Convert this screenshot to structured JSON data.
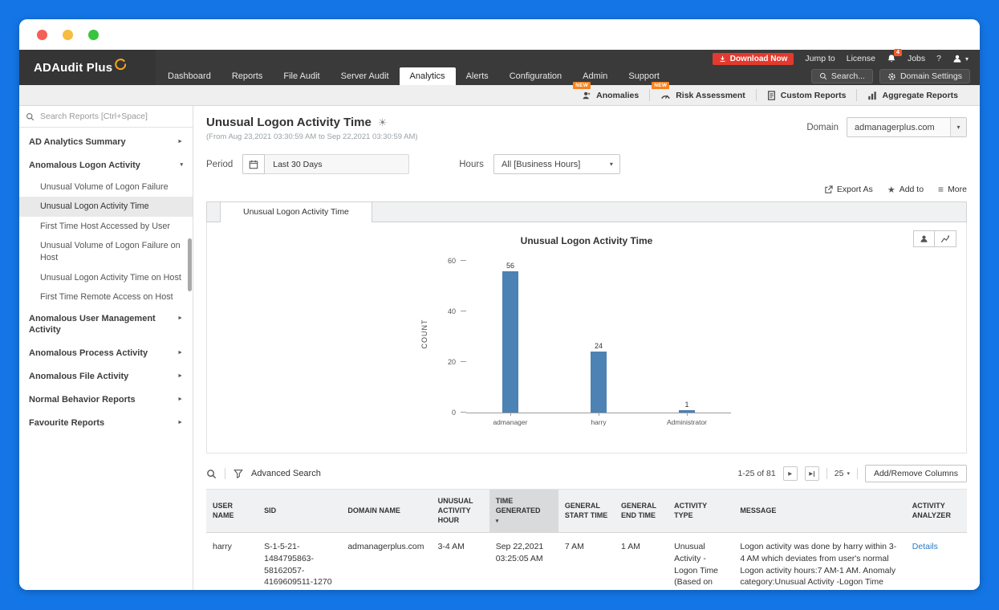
{
  "colors": {
    "frame_blue": "#1476E6",
    "header_dark": "#3a3a3a",
    "download_red": "#e23a2e",
    "badge_orange": "#f6821f",
    "bar_blue": "#4d82b4",
    "link_blue": "#2779c7"
  },
  "icons": {
    "caret_down": "▾",
    "caret_right": "►",
    "star": "★",
    "sun": "☀",
    "play": "▶",
    "more": "≡"
  },
  "topbar": {
    "brand": "ADAudit Plus",
    "download_label": "Download Now",
    "jump_to": "Jump to",
    "license": "License",
    "bell_count": "4",
    "jobs": "Jobs",
    "help": "?",
    "nav": [
      "Dashboard",
      "Reports",
      "File Audit",
      "Server Audit",
      "Analytics",
      "Alerts",
      "Configuration",
      "Admin",
      "Support"
    ],
    "active_nav": "Analytics",
    "search_label": "Search...",
    "domain_settings": "Domain Settings"
  },
  "ribbon": {
    "new_badge": "NEW",
    "anomalies": "Anomalies",
    "risk": "Risk Assessment",
    "custom": "Custom Reports",
    "aggregate": "Aggregate Reports"
  },
  "sidebar": {
    "search_placeholder": "Search Reports [Ctrl+Space]",
    "groups": [
      {
        "label": "AD Analytics Summary"
      },
      {
        "label": "Anomalous Logon Activity",
        "children": [
          "Unusual Volume of Logon Failure",
          "Unusual Logon Activity Time",
          "First Time Host Accessed by User",
          "Unusual Volume of Logon Failure on Host",
          "Unusual Logon Activity Time on Host",
          "First Time Remote Access on Host"
        ]
      },
      {
        "label": "Anomalous User Management Activity"
      },
      {
        "label": "Anomalous Process Activity"
      },
      {
        "label": "Anomalous File Activity"
      },
      {
        "label": "Normal Behavior Reports"
      },
      {
        "label": "Favourite Reports"
      }
    ],
    "selected": "Unusual Logon Activity Time"
  },
  "page": {
    "title": "Unusual Logon Activity Time",
    "subtitle": "(From Aug 23,2021 03:30:59 AM to Sep 22,2021 03:30:59 AM)",
    "domain_label": "Domain",
    "domain_value": "admanagerplus.com",
    "period_label": "Period",
    "period_value": "Last 30 Days",
    "hours_label": "Hours",
    "hours_value": "All [Business Hours]",
    "export_label": "Export As",
    "add_to_label": "Add to",
    "more_label": "More",
    "tab_label": "Unusual Logon Activity Time"
  },
  "chart_data": {
    "type": "bar",
    "title": "Unusual Logon Activity Time",
    "categories": [
      "admanager",
      "harry",
      "Administrator"
    ],
    "values": [
      56,
      24,
      1
    ],
    "ylabel": "COUNT",
    "xlabel": "",
    "yticks": [
      0,
      20,
      40,
      60
    ],
    "ylim": [
      0,
      60
    ],
    "grid": false,
    "legend": "none",
    "bar_color": "#4d82b4"
  },
  "table": {
    "advanced_search": "Advanced Search",
    "pagination": "1-25 of 81",
    "page_size": "25",
    "add_remove": "Add/Remove Columns",
    "sorted_column": "TIME GENERATED",
    "columns": [
      "USER NAME",
      "SID",
      "DOMAIN NAME",
      "UNUSUAL ACTIVITY HOUR",
      "TIME GENERATED",
      "GENERAL START TIME",
      "GENERAL END TIME",
      "ACTIVITY TYPE",
      "MESSAGE",
      "ACTIVITY ANALYZER"
    ],
    "rows": [
      {
        "user": "harry",
        "sid": "S-1-5-21-1484795863-58162057-4169609511-1270",
        "domain": "admanagerplus.com",
        "hour": "3-4 AM",
        "generated": "Sep 22,2021 03:25:05 AM",
        "start": "7 AM",
        "end": "1 AM",
        "type": "Unusual Activity - Logon Time (Based on User)",
        "message": "Logon activity was done by harry within 3-4 AM which deviates from user's normal Logon activity hours:7 AM-1 AM. Anomaly category:Unusual Activity -Logon Time (Based on User)",
        "analyzer": "Details"
      }
    ]
  }
}
